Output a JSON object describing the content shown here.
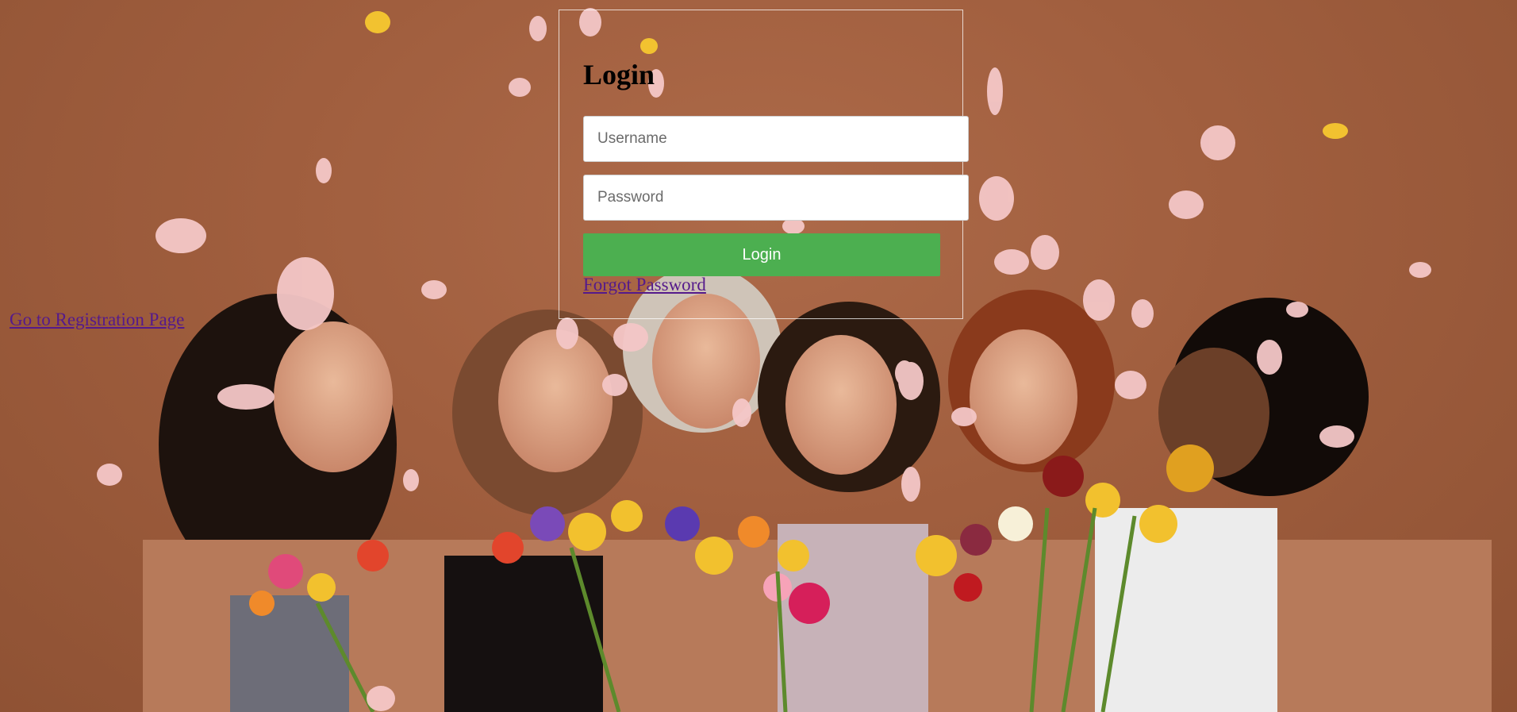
{
  "login": {
    "title": "Login",
    "username_placeholder": "Username",
    "password_placeholder": "Password",
    "submit_label": "Login",
    "forgot_password_label": "Forgot Password"
  },
  "registration_link_label": "Go to Registration Page",
  "colors": {
    "background": "#a0603f",
    "button": "#4caf50",
    "link_visited": "#551a8b"
  }
}
